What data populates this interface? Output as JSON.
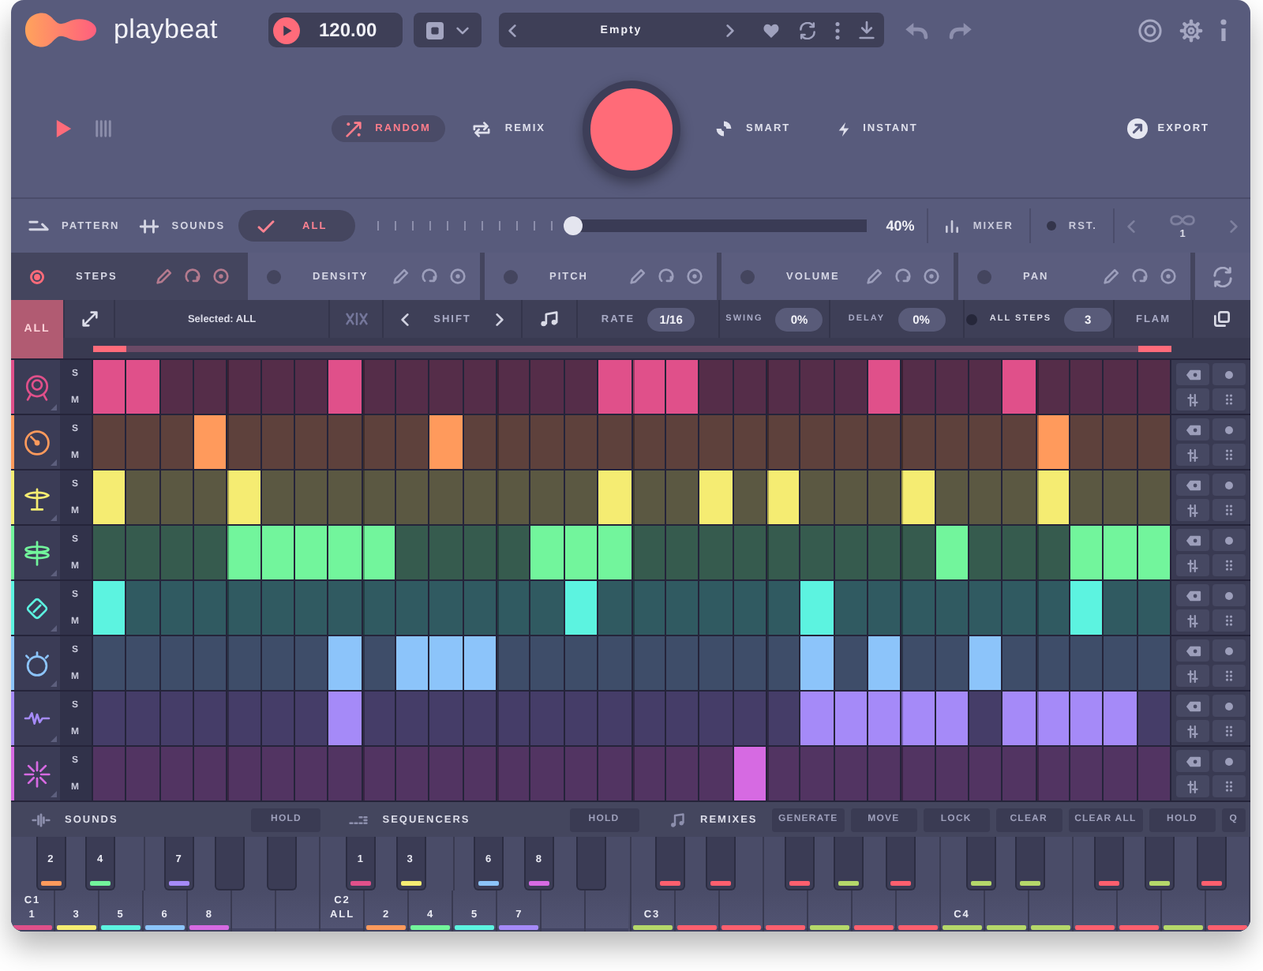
{
  "header": {
    "logo": "playbeat",
    "tempo": "120.00",
    "preset": "Empty"
  },
  "transport": {
    "modes": [
      {
        "label": "RANDOM",
        "selected": true
      },
      {
        "label": "REMIX",
        "selected": false
      },
      {
        "label": "SMART",
        "selected": false
      },
      {
        "label": "INSTANT",
        "selected": false
      }
    ],
    "export": "EXPORT"
  },
  "scope_tabs": [
    {
      "label": "PATTERN",
      "selected": false
    },
    {
      "label": "SOUNDS",
      "selected": false
    },
    {
      "label": "ALL",
      "selected": true
    }
  ],
  "amount": {
    "level": 0.4,
    "reading": "40%"
  },
  "mixer": "MIXER",
  "reset": "RST.",
  "pattern_page": "1",
  "lanes": [
    {
      "label": "STEPS",
      "selected": true
    },
    {
      "label": "DENSITY",
      "selected": false
    },
    {
      "label": "PITCH",
      "selected": false
    },
    {
      "label": "VOLUME",
      "selected": false
    },
    {
      "label": "PAN",
      "selected": false
    }
  ],
  "sequencer_bar": {
    "all": {
      "label": "ALL",
      "selected": true
    },
    "selection": "Selected: ALL",
    "shift": "SHIFT",
    "rate": {
      "label": "RATE",
      "value": "1/16"
    },
    "swing": {
      "label": "SWING",
      "value": "0%"
    },
    "delay": {
      "label": "DELAY",
      "value": "0%"
    },
    "all_steps": {
      "label": "ALL STEPS",
      "on": false,
      "value": "3"
    },
    "flam": "FLAM"
  },
  "tracks": [
    {
      "kind": "drum",
      "color": "#e0508a",
      "solo": "S",
      "mute": "M",
      "steps": [
        true,
        true,
        false,
        false,
        false,
        false,
        false,
        true,
        false,
        false,
        false,
        false,
        false,
        false,
        false,
        true,
        true,
        true,
        false,
        false,
        false,
        false,
        false,
        true,
        false,
        false,
        false,
        true,
        false,
        false,
        false,
        false
      ]
    },
    {
      "kind": "gauge",
      "color": "#ff9a5c",
      "solo": "S",
      "mute": "M",
      "steps": [
        false,
        false,
        false,
        true,
        false,
        false,
        false,
        false,
        false,
        false,
        true,
        false,
        false,
        false,
        false,
        false,
        false,
        false,
        false,
        false,
        false,
        false,
        false,
        false,
        false,
        false,
        false,
        false,
        true,
        false,
        false,
        false
      ]
    },
    {
      "kind": "cymbal",
      "color": "#f5ec72",
      "solo": "S",
      "mute": "M",
      "steps": [
        true,
        false,
        false,
        false,
        true,
        false,
        false,
        false,
        false,
        false,
        false,
        false,
        false,
        false,
        false,
        true,
        false,
        false,
        true,
        false,
        true,
        false,
        false,
        false,
        true,
        false,
        false,
        false,
        true,
        false,
        false,
        false
      ]
    },
    {
      "kind": "hihat",
      "color": "#72f59c",
      "solo": "S",
      "mute": "M",
      "steps": [
        false,
        false,
        false,
        false,
        true,
        true,
        true,
        true,
        true,
        false,
        false,
        false,
        false,
        true,
        true,
        true,
        false,
        false,
        false,
        false,
        false,
        false,
        false,
        false,
        false,
        true,
        false,
        false,
        false,
        true,
        true,
        true
      ]
    },
    {
      "kind": "diamond",
      "color": "#5cf3e0",
      "solo": "S",
      "mute": "M",
      "steps": [
        true,
        false,
        false,
        false,
        false,
        false,
        false,
        false,
        false,
        false,
        false,
        false,
        false,
        false,
        true,
        false,
        false,
        false,
        false,
        false,
        false,
        true,
        false,
        false,
        false,
        false,
        false,
        false,
        false,
        true,
        false,
        false
      ]
    },
    {
      "kind": "ring",
      "color": "#8cc4fa",
      "solo": "S",
      "mute": "M",
      "steps": [
        false,
        false,
        false,
        false,
        false,
        false,
        false,
        true,
        false,
        true,
        true,
        true,
        false,
        false,
        false,
        false,
        false,
        false,
        false,
        false,
        false,
        true,
        false,
        true,
        false,
        false,
        true,
        false,
        false,
        false,
        false,
        false
      ]
    },
    {
      "kind": "wave",
      "color": "#a58af8",
      "solo": "S",
      "mute": "M",
      "steps": [
        false,
        false,
        false,
        false,
        false,
        false,
        false,
        true,
        false,
        false,
        false,
        false,
        false,
        false,
        false,
        false,
        false,
        false,
        false,
        false,
        false,
        true,
        true,
        true,
        true,
        true,
        false,
        true,
        true,
        true,
        true,
        false
      ]
    },
    {
      "kind": "burst",
      "color": "#d66ae2",
      "solo": "S",
      "mute": "M",
      "steps": [
        false,
        false,
        false,
        false,
        false,
        false,
        false,
        false,
        false,
        false,
        false,
        false,
        false,
        false,
        false,
        false,
        false,
        false,
        false,
        true,
        false,
        false,
        false,
        false,
        false,
        false,
        false,
        false,
        false,
        false,
        false,
        false
      ]
    }
  ],
  "panels": {
    "sounds": {
      "title": "SOUNDS",
      "hold": "HOLD"
    },
    "sequencers": {
      "title": "SEQUENCERS",
      "hold": "HOLD"
    },
    "remixes": {
      "title": "REMIXES",
      "buttons": [
        "GENERATE",
        "MOVE",
        "LOCK",
        "CLEAR",
        "CLEAR ALL",
        "HOLD",
        "Q"
      ]
    }
  },
  "keyboard": {
    "octaves": [
      {
        "keys": [
          {
            "kind": "white",
            "note": "C1",
            "label": "1",
            "color": "#e0508a"
          },
          {
            "kind": "black",
            "label": "2",
            "color": "#ff9a5c"
          },
          {
            "kind": "white",
            "label": "3",
            "color": "#f5ec72"
          },
          {
            "kind": "black",
            "label": "4",
            "color": "#72f59c"
          },
          {
            "kind": "white",
            "label": "5",
            "color": "#5cf3e0"
          },
          {
            "kind": "white",
            "label": "6",
            "color": "#8cc4fa"
          },
          {
            "kind": "black",
            "label": "7",
            "color": "#a58af8"
          },
          {
            "kind": "white",
            "label": "8",
            "color": "#d66ae2"
          },
          {
            "kind": "black"
          },
          {
            "kind": "white"
          },
          {
            "kind": "black"
          },
          {
            "kind": "white"
          }
        ]
      },
      {
        "keys": [
          {
            "kind": "white",
            "note": "C2",
            "label": "ALL"
          },
          {
            "kind": "black",
            "label": "1",
            "color": "#e0508a"
          },
          {
            "kind": "white",
            "label": "2",
            "color": "#ff9a5c"
          },
          {
            "kind": "black",
            "label": "3",
            "color": "#f5ec72"
          },
          {
            "kind": "white",
            "label": "4",
            "color": "#72f59c"
          },
          {
            "kind": "white",
            "label": "5",
            "color": "#5cf3e0"
          },
          {
            "kind": "black",
            "label": "6",
            "color": "#8cc4fa"
          },
          {
            "kind": "white",
            "label": "7",
            "color": "#a58af8"
          },
          {
            "kind": "black",
            "label": "8",
            "color": "#d66ae2"
          },
          {
            "kind": "white"
          },
          {
            "kind": "black"
          },
          {
            "kind": "white"
          }
        ]
      },
      {
        "keys": [
          {
            "kind": "white",
            "note": "C3",
            "color": "#b5d86a"
          },
          {
            "kind": "black",
            "color": "#ff5f6e"
          },
          {
            "kind": "white",
            "color": "#ff5f6e"
          },
          {
            "kind": "black",
            "color": "#ff5f6e"
          },
          {
            "kind": "white",
            "color": "#ff5f6e"
          },
          {
            "kind": "white",
            "color": "#ff5f6e"
          },
          {
            "kind": "black",
            "color": "#ff5f6e"
          },
          {
            "kind": "white",
            "color": "#b5d86a"
          },
          {
            "kind": "black",
            "color": "#b5d86a"
          },
          {
            "kind": "white",
            "color": "#ff5f6e"
          },
          {
            "kind": "black",
            "color": "#ff5f6e"
          },
          {
            "kind": "white",
            "color": "#ff5f6e"
          }
        ]
      },
      {
        "keys": [
          {
            "kind": "white",
            "note": "C4",
            "color": "#b5d86a"
          },
          {
            "kind": "black",
            "color": "#b5d86a"
          },
          {
            "kind": "white",
            "color": "#b5d86a"
          },
          {
            "kind": "black",
            "color": "#b5d86a"
          },
          {
            "kind": "white",
            "color": "#b5d86a"
          },
          {
            "kind": "white",
            "color": "#ff5f6e"
          },
          {
            "kind": "black",
            "color": "#ff5f6e"
          },
          {
            "kind": "white",
            "color": "#ff5f6e"
          },
          {
            "kind": "black",
            "color": "#b5d86a"
          },
          {
            "kind": "white",
            "color": "#b5d86a"
          },
          {
            "kind": "black",
            "color": "#ff5f6e"
          },
          {
            "kind": "white",
            "color": "#ff5f6e"
          }
        ]
      }
    ]
  }
}
